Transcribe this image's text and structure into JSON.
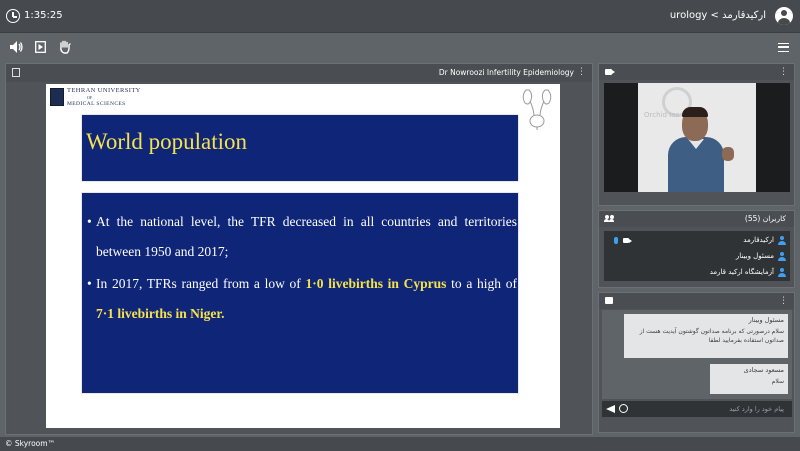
{
  "header": {
    "timer": "1:35:25",
    "room_path": "urology < ارکیدقارمد"
  },
  "toolbar": {
    "icons": [
      "speaker-icon",
      "media-play-icon",
      "raise-hand-icon",
      "menu-icon"
    ]
  },
  "presentation": {
    "title": "Dr Nowroozi Infertility Epidemiology",
    "slide": {
      "logo_lines": [
        "TEHRAN UNIVERSITY",
        "OF",
        "MEDICAL SCIENCES"
      ],
      "title": "World population",
      "bullet1": "At the national level, the TFR decreased in all countries and territories between 1950 and 2017;",
      "bullet2_pre": "In 2017, TFRs ranged from a low of ",
      "bullet2_hl1": "1·0 livebirths in Cyprus",
      "bullet2_mid": " to a high of ",
      "bullet2_hl2": "7·1 livebirths in Niger.",
      "highlight_color": "#f6e24d",
      "box_color": "#0e2578"
    }
  },
  "video": {
    "wall_text": "Orchid Ins"
  },
  "users": {
    "title": "کاربران (55)",
    "list": [
      {
        "name": "ارکیدقارمد",
        "mic": true,
        "cam": true
      },
      {
        "name": "مسئول وبینار",
        "mic": false,
        "cam": false
      },
      {
        "name": "آزمایشگاه ارکید قارمد",
        "mic": false,
        "cam": false
      }
    ]
  },
  "chat": {
    "messages": [
      {
        "sender": "مسئول وبینار",
        "text": "سلام درصورتی که برنامه صداتون گوشتون آیدیت هست از صداتون استفاده بفرمایید لطفا"
      },
      {
        "sender": "مسعود سجادی",
        "text": "سلام"
      }
    ],
    "placeholder": "پیام خود را وارد کنید"
  },
  "footer": {
    "brand": "© Skyroom™"
  },
  "colors": {
    "accent": "#3fa0f0",
    "topbar": "#464a4f",
    "background": "#5f6468"
  }
}
